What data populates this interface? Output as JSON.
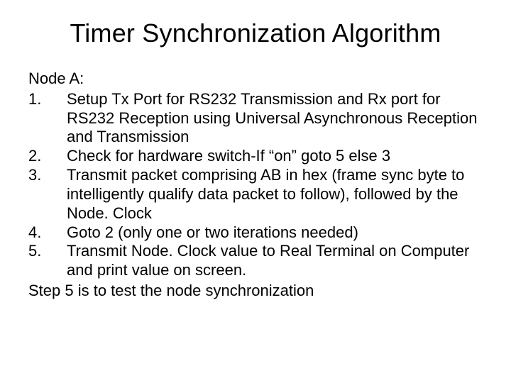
{
  "title": "Timer Synchronization Algorithm",
  "intro": "Node A:",
  "items": [
    {
      "num": "1.",
      "text": "Setup Tx Port for RS232 Transmission and Rx port for RS232 Reception using Universal Asynchronous Reception and Transmission"
    },
    {
      "num": "2.",
      "text": "Check for hardware switch-If “on” goto 5 else 3"
    },
    {
      "num": "3.",
      "text": "Transmit packet comprising AB in hex (frame sync byte to intelligently qualify data packet to follow), followed by the Node. Clock"
    },
    {
      "num": "4.",
      "text": "Goto 2 (only one or two iterations needed)"
    },
    {
      "num": "5.",
      "text": "Transmit Node. Clock value to Real Terminal on Computer and print value on screen."
    }
  ],
  "tail": "Step 5 is to test the node synchronization"
}
